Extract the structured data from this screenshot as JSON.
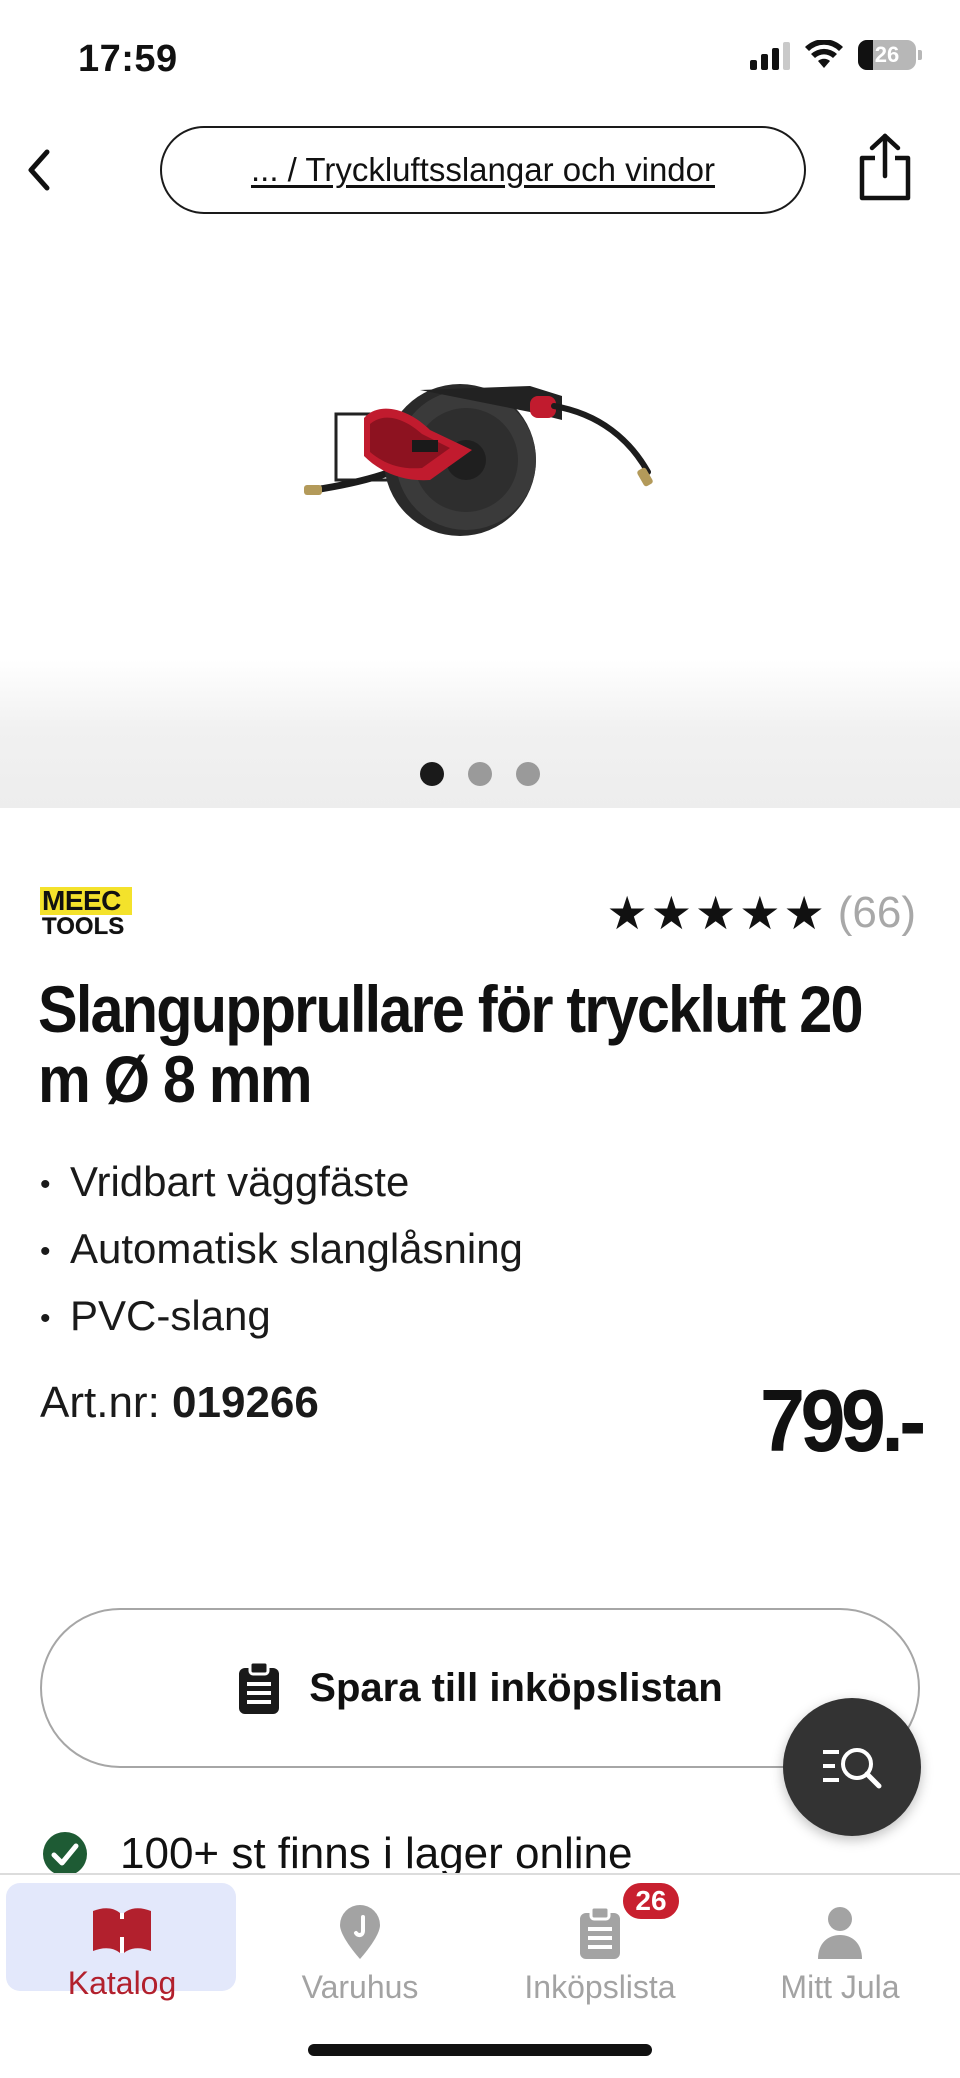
{
  "status_bar": {
    "time": "17:59",
    "battery": "26",
    "icons": [
      "signal-icon",
      "wifi-icon",
      "battery-icon"
    ]
  },
  "nav": {
    "back_icon": "chevron-left-icon",
    "breadcrumb": "... / Tryckluftsslangar och vindor",
    "share_icon": "share-icon"
  },
  "gallery": {
    "image_alt": "hose reel product image",
    "dots": 3,
    "active_dot": 0
  },
  "product": {
    "brand_logo_line1": "MEEC",
    "brand_logo_line2": "TOOLS",
    "stars": "★★★★★",
    "rating": 5,
    "review_count": "(66)",
    "title": "Slangupprullare för tryckluft 20 m Ø 8 mm",
    "bullets": [
      "Vridbart väggfäste",
      "Automatisk slanglåsning",
      "PVC-slang"
    ],
    "artnr_label": "Art.nr:",
    "artnr_value": "019266",
    "price": "799.-"
  },
  "actions": {
    "save_label": "Spara till inköpslistan",
    "save_icon": "clipboard-icon",
    "search_fab_icon": "search-list-icon"
  },
  "stock": {
    "text": "100+ st finns i lager online",
    "icon": "check-circle-icon",
    "color": "#1e5b34"
  },
  "tabbar": {
    "tabs": [
      {
        "label": "Katalog",
        "icon": "book-icon",
        "active": true
      },
      {
        "label": "Varuhus",
        "icon": "location-pin-icon",
        "active": false
      },
      {
        "label": "Inköpslista",
        "icon": "clipboard-icon",
        "active": false
      },
      {
        "label": "Mitt Jula",
        "icon": "person-icon",
        "active": false
      }
    ],
    "badge": "26",
    "active_color": "#b2202d",
    "inactive_color": "#a3a3a3"
  }
}
